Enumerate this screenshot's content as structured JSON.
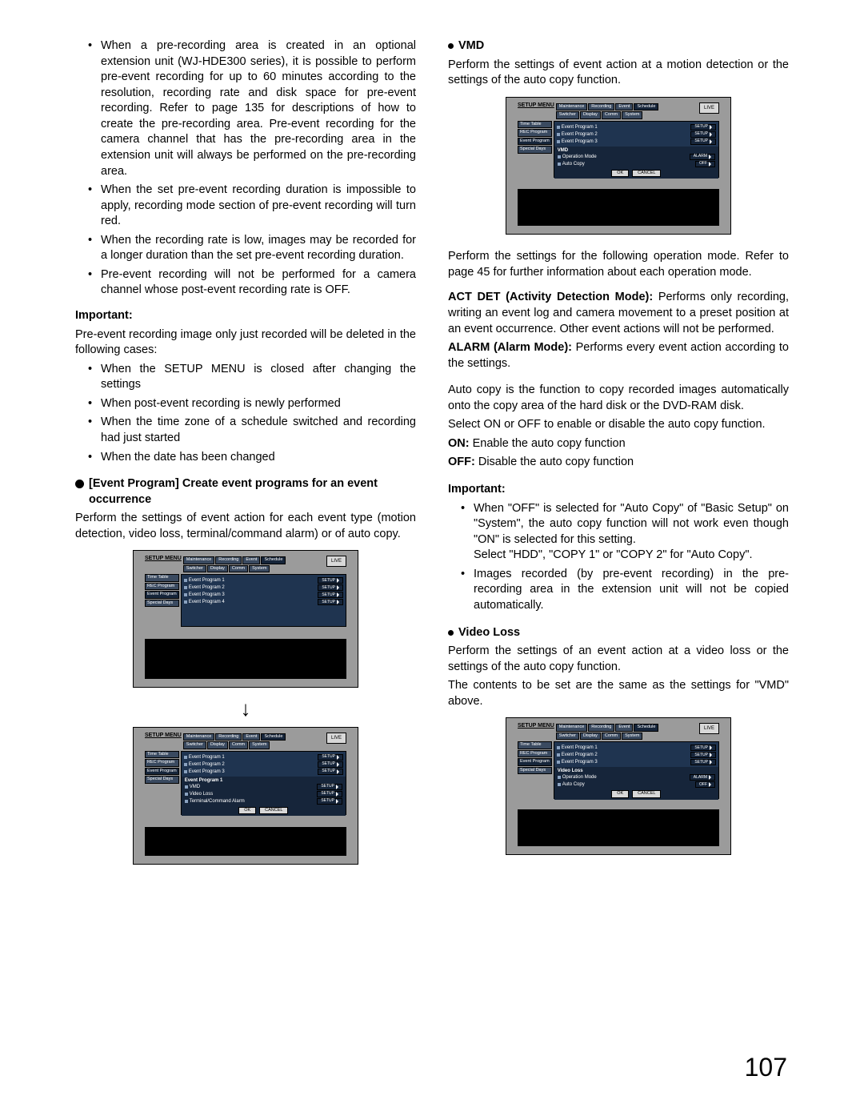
{
  "page_number": "107",
  "left": {
    "bullets1": [
      "When a pre-recording area is created in an optional extension unit (WJ-HDE300 series), it is possible to perform pre-event recording for up to 60 minutes according to the resolution, recording rate and disk space for pre-event recording. Refer to page 135 for descriptions of how to create the pre-recording area. Pre-event recording for the camera channel that has the pre-recording area in the extension unit will always be performed on the pre-recording area.",
      "When the set pre-event recording duration is impossible to apply, recording mode section of pre-event recording will turn red.",
      "When the recording rate is low, images may be recorded for a longer duration than the set pre-event recording duration.",
      "Pre-event recording will not be performed for a camera channel whose post-event recording rate is OFF."
    ],
    "important_label": "Important:",
    "important_intro": "Pre-event recording image only just recorded will be deleted in the following cases:",
    "important_bullets": [
      "When the SETUP MENU is closed after changing the settings",
      "When post-event recording is newly performed",
      "When the time zone of a schedule switched and recording had just started",
      "When the date has been changed"
    ],
    "section_title": "[Event Program] Create event programs for an event occurrence",
    "section_intro": "Perform the settings of event action for each event type (motion detection, video loss, terminal/command alarm) or of auto copy."
  },
  "right": {
    "vmd_title": "VMD",
    "vmd_intro": "Perform the settings of event action at a motion detection or the settings of the auto copy function.",
    "vmd_after_fig": "Perform the settings for the following operation mode. Refer to page 45 for further information about each operation mode.",
    "defs": [
      {
        "term": "ACT DET (Activity Detection Mode):",
        "desc": " Performs only recording, writing an event log and camera movement to a preset position at an event occurrence. Other event actions will not be performed."
      },
      {
        "term": "ALARM (Alarm Mode):",
        "desc": " Performs every event action according to the settings."
      }
    ],
    "autocopy_p1": "Auto copy is the function to copy recorded images automatically onto the copy area of the hard disk or the DVD-RAM disk.",
    "autocopy_p2": "Select ON or OFF to enable or disable the auto copy function.",
    "on_label": "ON:",
    "on_desc": " Enable the auto copy function",
    "off_label": "OFF:",
    "off_desc": " Disable the auto copy function",
    "important_label": "Important:",
    "important_bullets": [
      "When \"OFF\" is selected for \"Auto Copy\" of \"Basic Setup\" on \"System\", the auto copy function will not work even though \"ON\" is selected for this setting.\nSelect \"HDD\", \"COPY 1\" or \"COPY 2\" for \"Auto Copy\".",
      "Images recorded (by pre-event recording) in the pre-recording area in the extension unit will not be copied automatically."
    ],
    "videoloss_title": "Video Loss",
    "videoloss_p1": "Perform the settings of an event action at a video loss or the settings of the auto copy function.",
    "videoloss_p2": "The contents to be set are the same as the settings for \"VMD\" above."
  },
  "fig": {
    "setup_menu": "SETUP MENU",
    "tabs_top": [
      "Maintenance",
      "Recording",
      "Event",
      "Schedule"
    ],
    "tabs_bot": [
      "Switcher",
      "Display",
      "Comm",
      "System"
    ],
    "live": "LIVE",
    "side": [
      "Time Table",
      "REC Program",
      "Event Program",
      "Special Days"
    ],
    "programs": [
      "Event Program 1",
      "Event Program 2",
      "Event Program 3",
      "Event Program 4"
    ],
    "programs3": [
      "Event Program 1",
      "Event Program 2",
      "Event Program 3"
    ],
    "setup_btn": "SETUP",
    "vmd_sub_title": "VMD",
    "videoloss_sub_title": "Video Loss",
    "ep1_title": "Event Program 1",
    "ep1_rows": [
      "VMD",
      "Video Loss",
      "Terminal/Command Alarm"
    ],
    "op_mode": "Operation Mode",
    "auto_copy": "Auto Copy",
    "alarm": "ALARM",
    "off": "OFF",
    "ok": "OK",
    "cancel": "CANCEL"
  }
}
